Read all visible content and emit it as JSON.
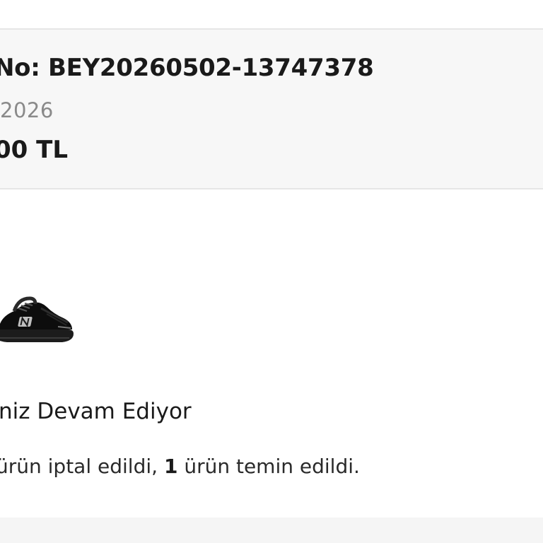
{
  "order": {
    "number_text": "No: BEY20260502-13747378",
    "date_text": "2026",
    "total_text": "00 TL"
  },
  "product": {
    "image_icon": "sneaker-icon",
    "brand_mark": "N"
  },
  "status": {
    "title": "niz Devam Ediyor",
    "desc_prefix": "ürün iptal edildi, ",
    "desc_count": "1",
    "desc_suffix": " ürün temin edildi."
  },
  "colors": {
    "card_background": "#f7f7f7",
    "divider": "#e6e6e6",
    "muted_text": "#8a8a8a",
    "primary_text": "#1a1a1a"
  }
}
